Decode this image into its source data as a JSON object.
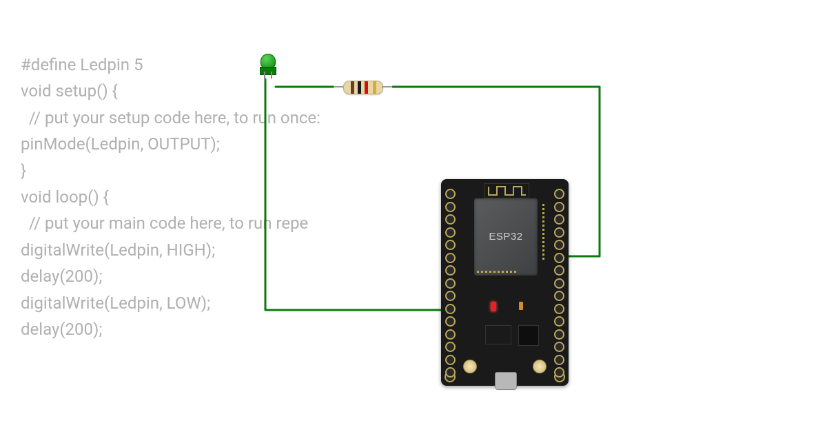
{
  "code": {
    "lines": [
      "#define Ledpin 5",
      "void setup() {",
      "  // put your setup code here, to run once:",
      "pinMode(Ledpin, OUTPUT);",
      "}",
      "",
      "void loop() {",
      "  // put your main code here, to run repe",
      "digitalWrite(Ledpin, HIGH);",
      "delay(200);",
      "digitalWrite(Ledpin, LOW);",
      "delay(200);"
    ]
  },
  "board": {
    "chip_label": "ESP32"
  },
  "components": {
    "led_color": "green",
    "resistor_bands": [
      "brown",
      "black",
      "red",
      "gold"
    ]
  },
  "colors": {
    "wire": "#0b7a0b",
    "code_text": "#b0b0b0",
    "board_bg": "#1a1a1a",
    "pad": "#bba85a"
  }
}
